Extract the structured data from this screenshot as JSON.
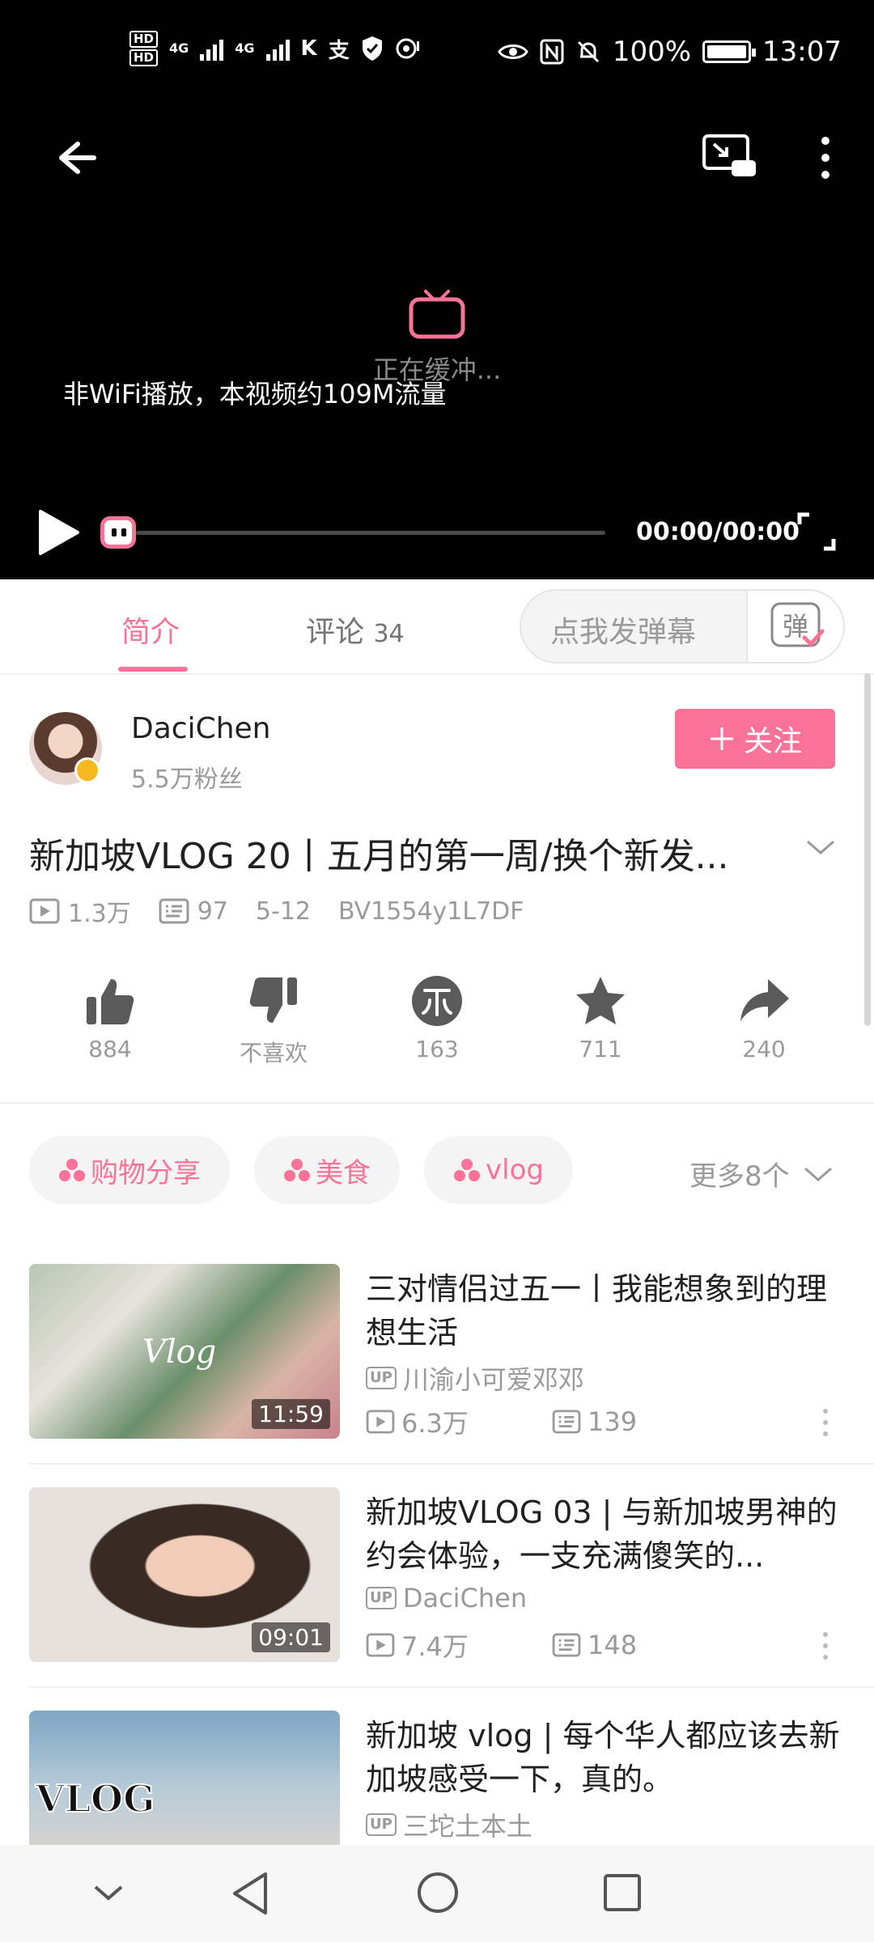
{
  "status_bar": {
    "hd1": "HD",
    "hd2": "HD",
    "net1": "4G",
    "net2": "4G",
    "battery_pct": "100%",
    "time": "13:07"
  },
  "player": {
    "buffering_text": "正在缓冲...",
    "network_tip": "非WiFi播放，本视频约109M流量",
    "time_display": "00:00/00:00",
    "progress": 0
  },
  "tabs": [
    {
      "label": "简介",
      "count": ""
    },
    {
      "label": "评论",
      "count": "34"
    }
  ],
  "danmaku": {
    "placeholder": "点我发弹幕",
    "toggle_label": "弹"
  },
  "uploader": {
    "name": "DaciChen",
    "fans": "5.5万粉丝",
    "follow_label": "关注"
  },
  "video": {
    "title": "新加坡VLOG 20丨五月的第一周/换个新发...",
    "views": "1.3万",
    "danmaku_count": "97",
    "date": "5-12",
    "bvid": "BV1554y1L7DF"
  },
  "actions": [
    {
      "name": "like",
      "label": "884"
    },
    {
      "name": "dislike",
      "label": "不喜欢"
    },
    {
      "name": "coin",
      "label": "163"
    },
    {
      "name": "favorite",
      "label": "711"
    },
    {
      "name": "share",
      "label": "240"
    }
  ],
  "tags": [
    "购物分享",
    "美食",
    "vlog"
  ],
  "tags_more": "更多8个",
  "related": [
    {
      "title": "三对情侣过五一丨我能想象到的理想生活",
      "up": "川渝小可爱邓邓",
      "views": "6.3万",
      "danmaku": "139",
      "duration": "11:59",
      "thumb_text": "Vlog"
    },
    {
      "title": "新加坡VLOG 03 | 与新加坡男神的约会体验，一支充满傻笑的...",
      "up": "DaciChen",
      "views": "7.4万",
      "danmaku": "148",
      "duration": "09:01",
      "thumb_text": ""
    },
    {
      "title": "新加坡 vlog | 每个华人都应该去新加坡感受一下，真的。",
      "up": "三坨土本土",
      "views": "",
      "danmaku": "",
      "duration": "",
      "thumb_text": "VLOG"
    }
  ],
  "up_badge": "UP",
  "colors": {
    "accent": "#fb7299",
    "text_primary": "#212121",
    "text_secondary": "#9a9a9a",
    "player_bg": "#000000"
  }
}
